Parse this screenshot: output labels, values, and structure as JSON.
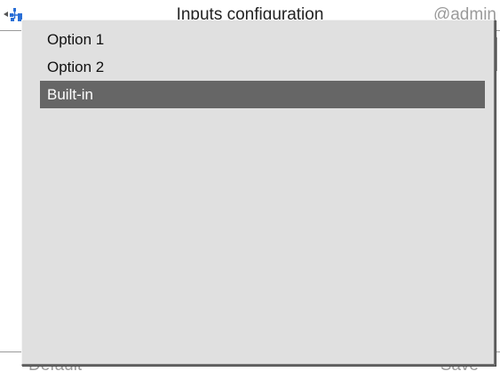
{
  "header": {
    "title": "Inputs configuration",
    "user": "@admin",
    "nav_icon": "back-arrow-network-icon"
  },
  "footer": {
    "default_label": "Default",
    "save_label": "Save"
  },
  "dropdown": {
    "options": [
      {
        "label": "Option 1",
        "selected": false
      },
      {
        "label": "Option 2",
        "selected": false
      },
      {
        "label": "Built-in",
        "selected": true
      }
    ],
    "selected_color": "#666666",
    "background_color": "#e0e0e0"
  }
}
